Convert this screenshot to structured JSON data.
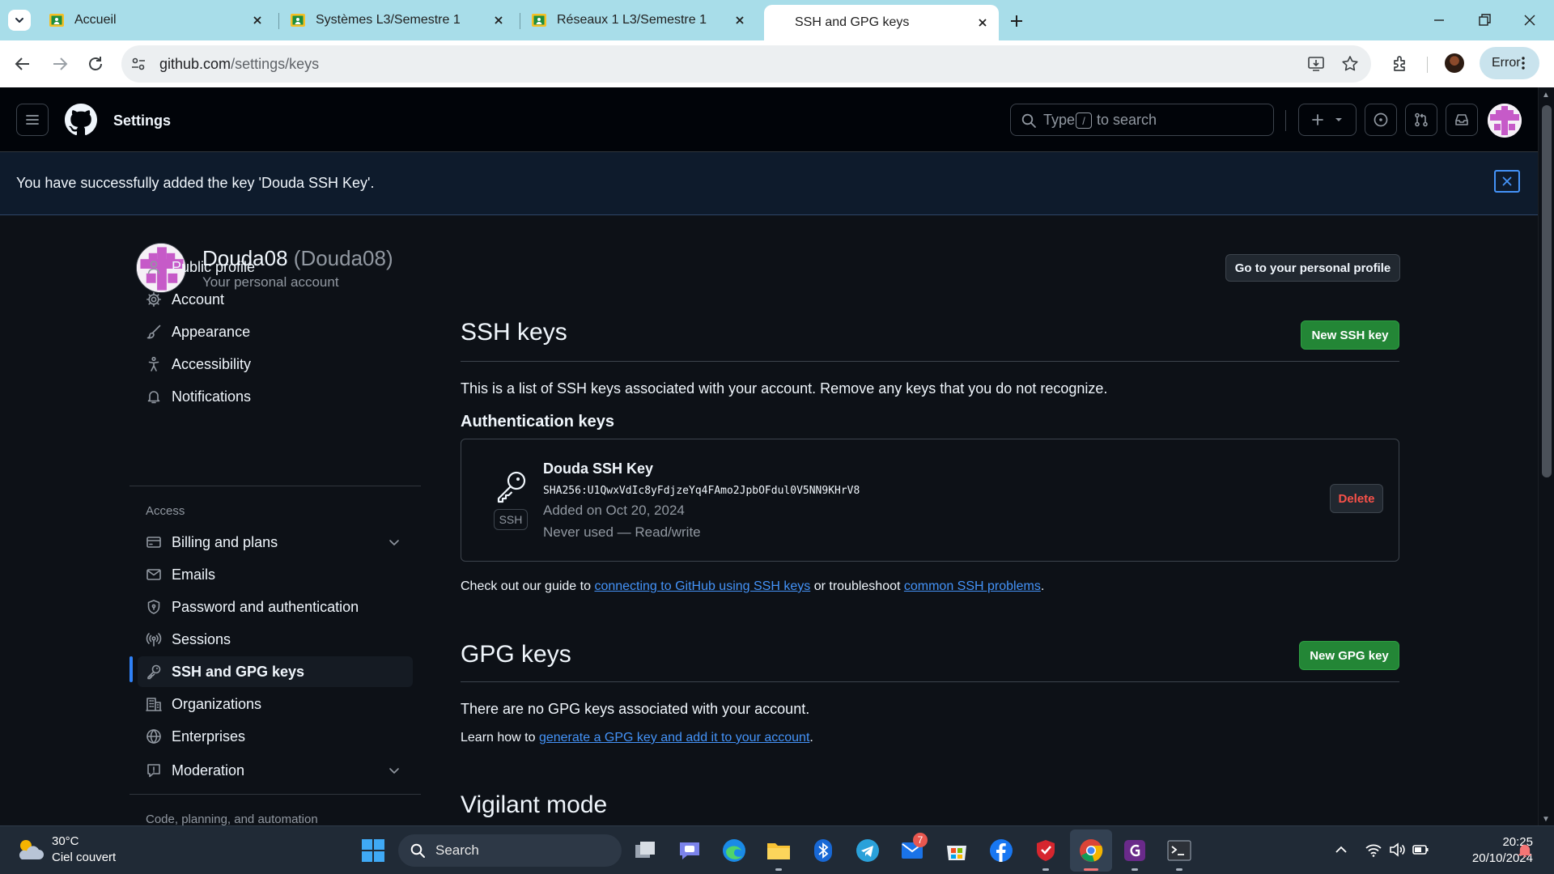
{
  "browser": {
    "tabs": [
      {
        "label": "Accueil"
      },
      {
        "label": "Systèmes L3/Semestre 1"
      },
      {
        "label": "Réseaux 1 L3/Semestre 1"
      },
      {
        "label": "SSH and GPG keys"
      }
    ],
    "url_host": "github.com",
    "url_path": "/settings/keys",
    "profile_label": "Error"
  },
  "header": {
    "title": "Settings",
    "search_prefix": "Type",
    "search_key": "/",
    "search_suffix": "to search"
  },
  "flash": {
    "message": "You have successfully added the key 'Douda SSH Key'."
  },
  "user": {
    "name": "Douda08",
    "handle": "(Douda08)",
    "subtitle": "Your personal account",
    "profile_button": "Go to your personal profile"
  },
  "sidebar": {
    "items": [
      {
        "label": "Public profile"
      },
      {
        "label": "Account"
      },
      {
        "label": "Appearance"
      },
      {
        "label": "Accessibility"
      },
      {
        "label": "Notifications"
      }
    ],
    "access_heading": "Access",
    "access_items": [
      {
        "label": "Billing and plans"
      },
      {
        "label": "Emails"
      },
      {
        "label": "Password and authentication"
      },
      {
        "label": "Sessions"
      },
      {
        "label": "SSH and GPG keys"
      },
      {
        "label": "Organizations"
      },
      {
        "label": "Enterprises"
      },
      {
        "label": "Moderation"
      }
    ],
    "code_heading": "Code, planning, and automation"
  },
  "ssh": {
    "title": "SSH keys",
    "new_button": "New SSH key",
    "description": "This is a list of SSH keys associated with your account. Remove any keys that you do not recognize.",
    "auth_heading": "Authentication keys",
    "key": {
      "title": "Douda SSH Key",
      "fingerprint": "SHA256:U1QwxVdIc8yFdjzeYq4FAmo2JpbOFdul0V5NN9KHrV8",
      "added": "Added on Oct 20, 2024",
      "usage": "Never used — Read/write",
      "type": "SSH",
      "delete_label": "Delete"
    },
    "guide_prefix": "Check out our guide to ",
    "guide_link1": "connecting to GitHub using SSH keys",
    "guide_middle": " or troubleshoot ",
    "guide_link2": "common SSH problems",
    "guide_suffix": "."
  },
  "gpg": {
    "title": "GPG keys",
    "new_button": "New GPG key",
    "empty": "There are no GPG keys associated with your account.",
    "learn_prefix": "Learn how to ",
    "learn_link": "generate a GPG key and add it to your account",
    "learn_suffix": "."
  },
  "vigilant": {
    "title": "Vigilant mode"
  },
  "taskbar": {
    "temperature": "30°C",
    "weather": "Ciel couvert",
    "search_label": "Search",
    "mail_badge": "7",
    "time": "20:25",
    "date": "20/10/2024"
  }
}
